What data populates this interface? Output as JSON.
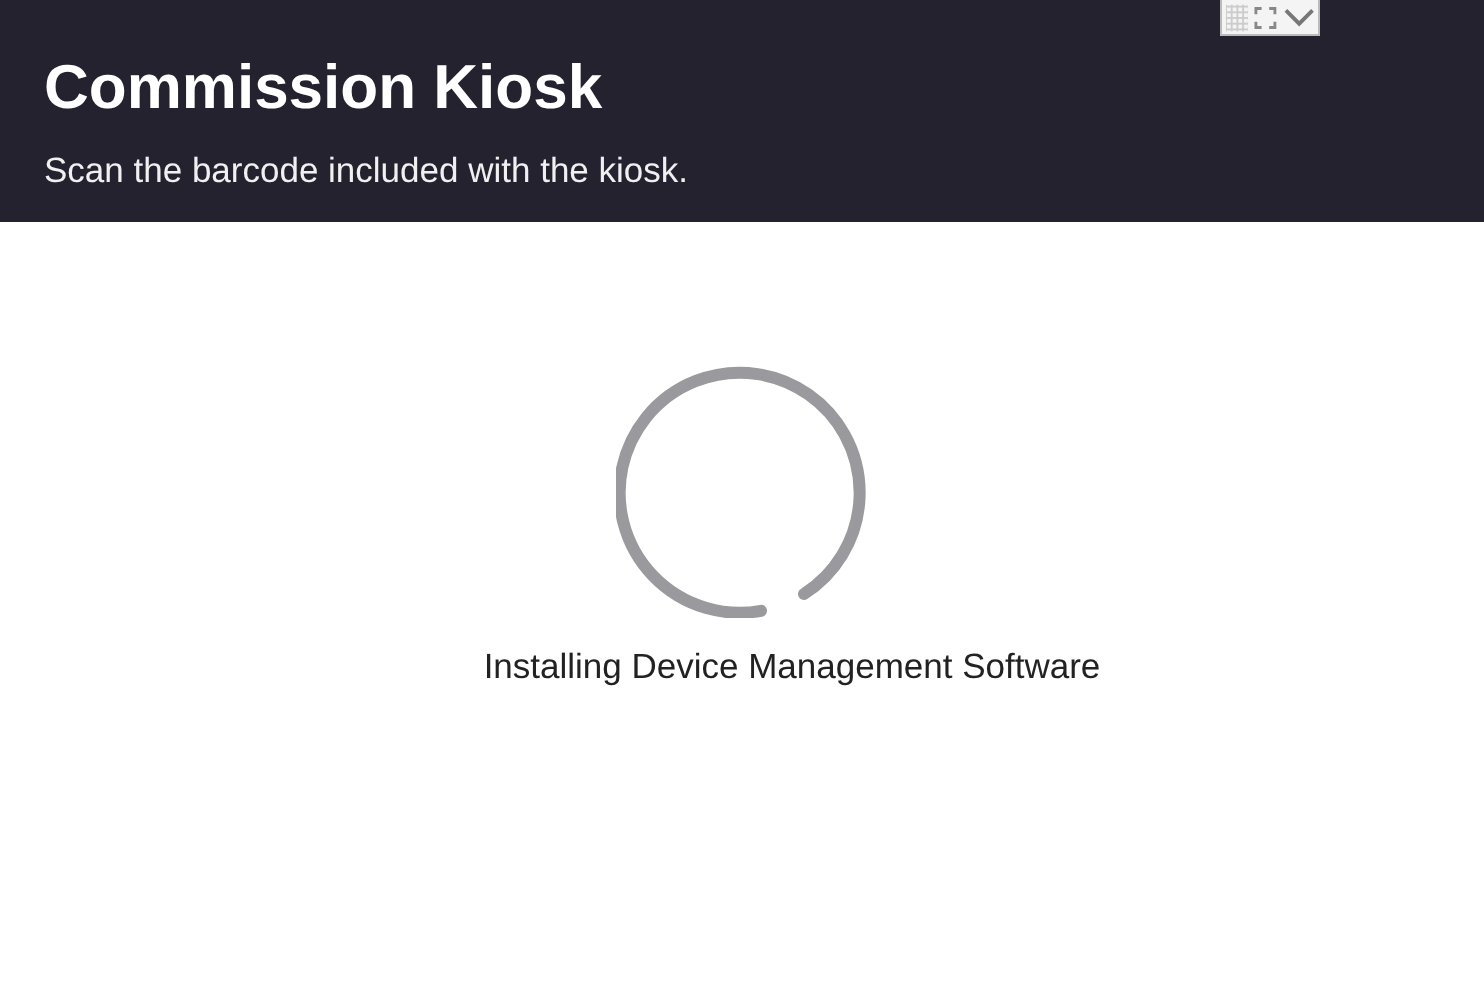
{
  "header": {
    "title": "Commission Kiosk",
    "subtitle": "Scan the barcode included with the kiosk."
  },
  "status": {
    "message": "Installing Device Management Software"
  }
}
